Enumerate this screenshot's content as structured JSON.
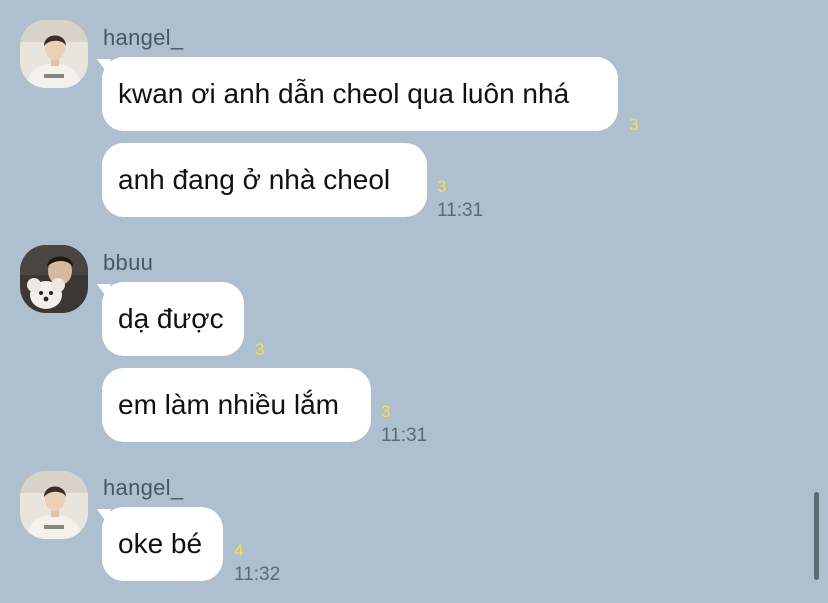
{
  "messages": {
    "group1": {
      "sender": "hangel_",
      "bubble1": {
        "text": "kwan ơi anh dẫn cheol qua luôn nhá",
        "count": "3"
      },
      "bubble2": {
        "text": "anh đang ở nhà cheol",
        "count": "3",
        "time": "11:31"
      }
    },
    "group2": {
      "sender": "bbuu",
      "bubble1": {
        "text": "dạ được",
        "count": "3"
      },
      "bubble2": {
        "text": "em làm nhiều lắm",
        "count": "3",
        "time": "11:31"
      }
    },
    "group3": {
      "sender": "hangel_",
      "bubble1": {
        "text": "oke bé",
        "count": "4",
        "time": "11:32"
      }
    }
  },
  "icons": {
    "avatar_hangel": "profile-photo-person-white-shirt",
    "avatar_bbuu": "profile-photo-person-with-white-dog"
  },
  "colors": {
    "background": "#aebfcf",
    "bubble": "#ffffff",
    "unread_count": "#f2e24c",
    "timestamp": "#5e6873"
  }
}
